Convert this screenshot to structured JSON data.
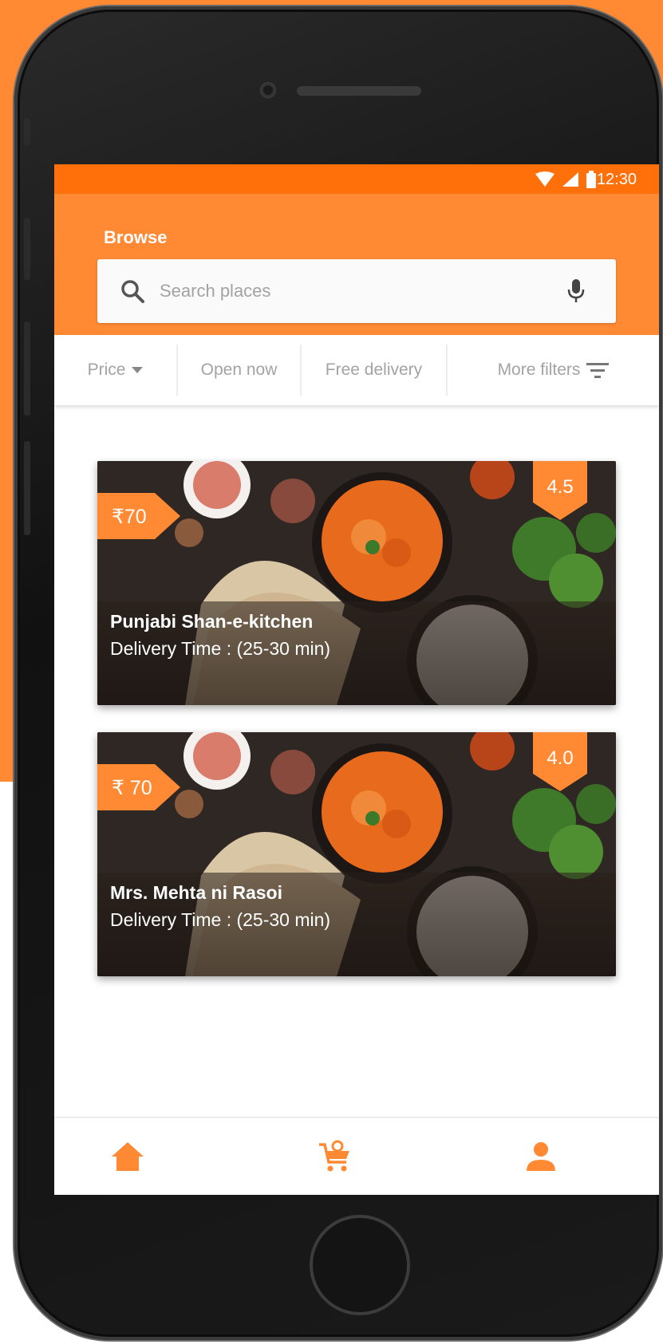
{
  "theme": {
    "accent": "#ff8a33",
    "status_bar": "#ff6f0a"
  },
  "status_bar": {
    "time": "12:30",
    "icons": [
      "wifi-icon",
      "signal-icon",
      "battery-icon"
    ]
  },
  "header": {
    "title": "Browse",
    "search": {
      "placeholder": "Search places",
      "value": ""
    }
  },
  "filters": [
    {
      "label": "Price",
      "icon": "dropdown-arrow-icon"
    },
    {
      "label": "Open now"
    },
    {
      "label": "Free delivery"
    },
    {
      "label": "More filters",
      "icon": "filter-icon"
    }
  ],
  "restaurants": [
    {
      "name": "Punjabi Shan-e-kitchen",
      "delivery": "Delivery Time :  (25-30 min)",
      "price": "₹70",
      "rating": "4.5"
    },
    {
      "name": "Mrs. Mehta ni Rasoi",
      "delivery": "Delivery Time :  (25-30 min)",
      "price": "₹ 70",
      "rating": "4.0"
    }
  ],
  "bottom_nav": [
    {
      "name": "home",
      "icon": "home-icon"
    },
    {
      "name": "cart",
      "icon": "cart-icon"
    },
    {
      "name": "profile",
      "icon": "profile-icon"
    }
  ]
}
